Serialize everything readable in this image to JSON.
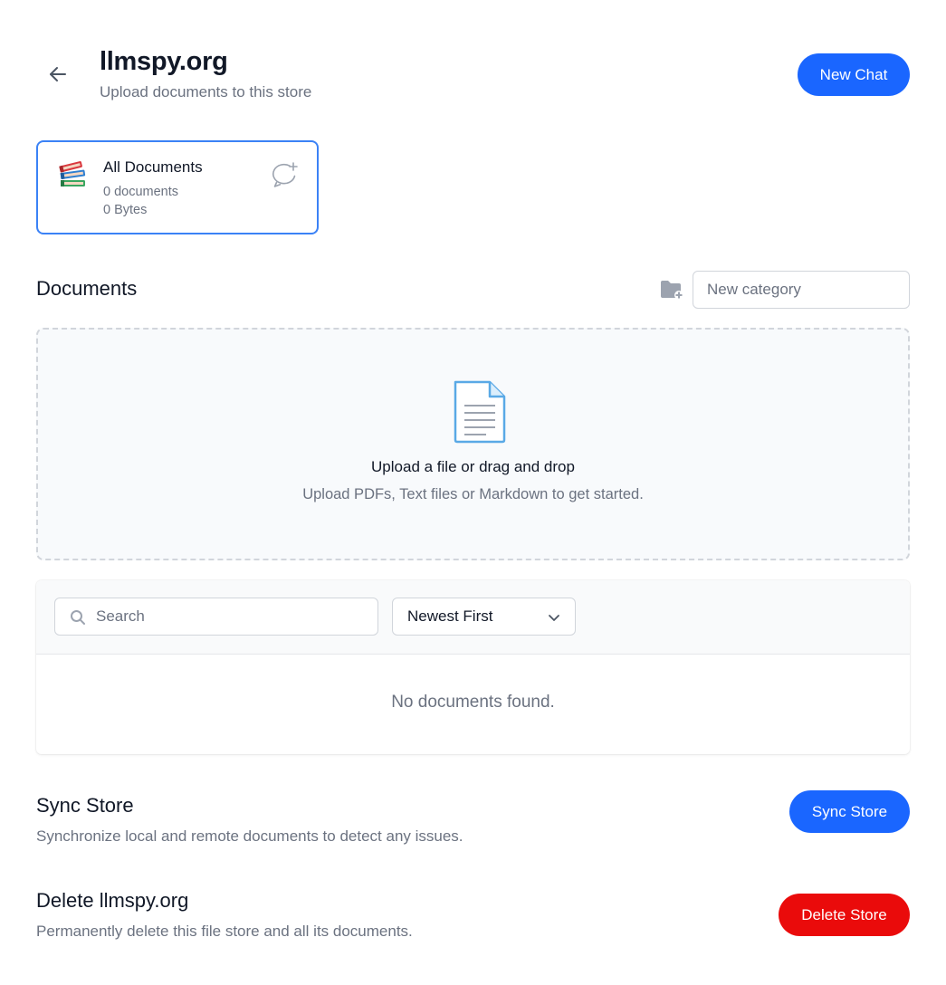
{
  "header": {
    "title": "llmspy.org",
    "subtitle": "Upload documents to this store",
    "new_chat_label": "New Chat",
    "back_icon": "arrow-left-icon"
  },
  "store_card": {
    "icon": "books-icon",
    "title": "All Documents",
    "count": "0 documents",
    "size": "0 Bytes",
    "chat_icon": "chat-add-icon"
  },
  "documents": {
    "section_title": "Documents",
    "folder_icon": "folder-plus-icon",
    "category_placeholder": "New category",
    "category_value": ""
  },
  "dropzone": {
    "icon": "document-icon",
    "title": "Upload a file or drag and drop",
    "subtitle": "Upload PDFs, Text files or Markdown to get started."
  },
  "list": {
    "search_placeholder": "Search",
    "search_value": "",
    "sort_selected": "Newest First",
    "empty_message": "No documents found."
  },
  "sync": {
    "title": "Sync Store",
    "description": "Synchronize local and remote documents to detect any issues.",
    "button_label": "Sync Store"
  },
  "delete": {
    "title": "Delete llmspy.org",
    "description": "Permanently delete this file store and all its documents.",
    "button_label": "Delete Store"
  },
  "colors": {
    "primary": "#1a66ff",
    "danger": "#ea0b0b",
    "selected_border": "#3b82f6",
    "muted_text": "#6b7280"
  }
}
